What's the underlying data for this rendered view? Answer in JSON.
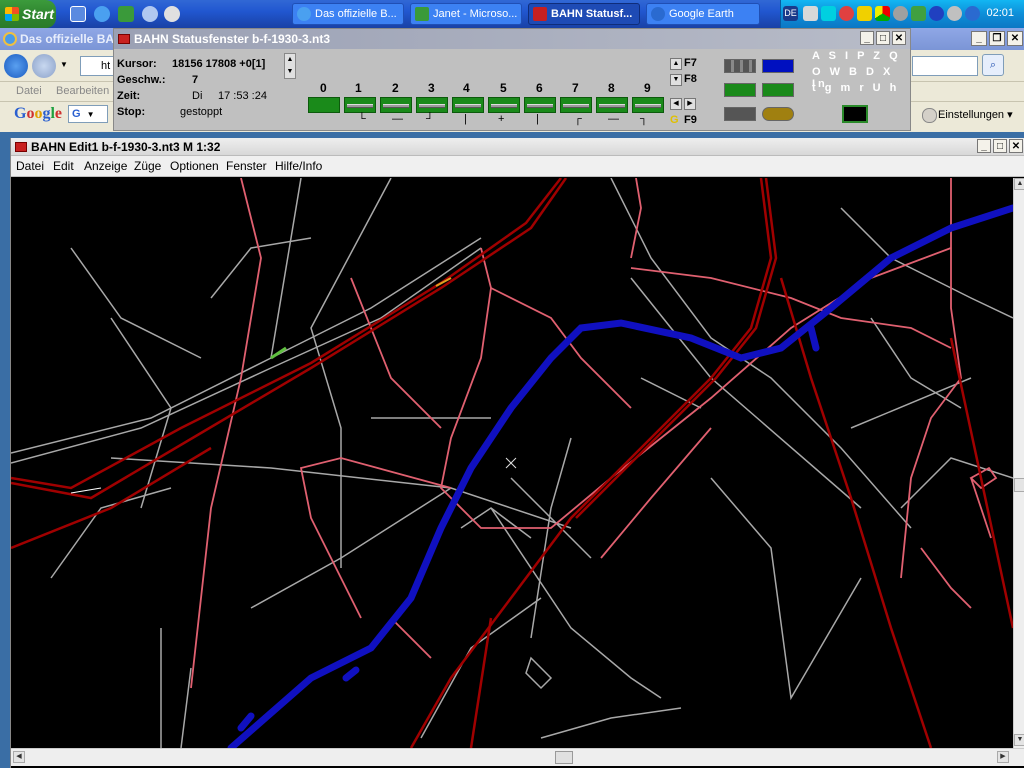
{
  "taskbar": {
    "start_label": "Start",
    "tasks": [
      {
        "label": "Das offizielle B..."
      },
      {
        "label": "Janet - Microso..."
      },
      {
        "label": "BAHN Statusf..."
      },
      {
        "label": "Google Earth"
      }
    ],
    "tray_lang": "DE",
    "clock": "02:01"
  },
  "ie": {
    "title": "Das offizielle BAH",
    "address_prefix": "ht",
    "menu": [
      "Datei",
      "Bearbeiten"
    ],
    "google_logo": "Google",
    "google_box": "G",
    "settings_label": "Einstellungen"
  },
  "status": {
    "title": "BAHN Statusfenster b-f-1930-3.nt3",
    "labels": {
      "kursor": "Kursor:",
      "geschw": "Geschw.:",
      "zeit": "Zeit:",
      "stop": "Stop:"
    },
    "values": {
      "kursor": "18156 17808 +0[1]",
      "geschw": "7",
      "zeit_day": "Di",
      "zeit_time": "17 :53 :24",
      "stop": "gestoppt"
    },
    "track_numbers": [
      "0",
      "1",
      "2",
      "3",
      "4",
      "5",
      "6",
      "7",
      "8",
      "9"
    ],
    "fkeys": {
      "f7": "F7",
      "f8": "F8",
      "f9": "F9",
      "g": "G"
    },
    "letters_rows": [
      "A S I P Z Q",
      "O W B D X In",
      "t g m r U h"
    ]
  },
  "edit": {
    "title": "BAHN Edit1 b-f-1930-3.nt3 M 1:32",
    "menu": [
      "Datei",
      "Edit",
      "Anzeige",
      "Züge",
      "Optionen",
      "Fenster",
      "Hilfe/Info"
    ]
  },
  "colors": {
    "tram": "#e06070",
    "rail": "#a00000",
    "river": "#1010c0",
    "street": "#a8a8a8",
    "track_green": "#1a8a1a"
  }
}
